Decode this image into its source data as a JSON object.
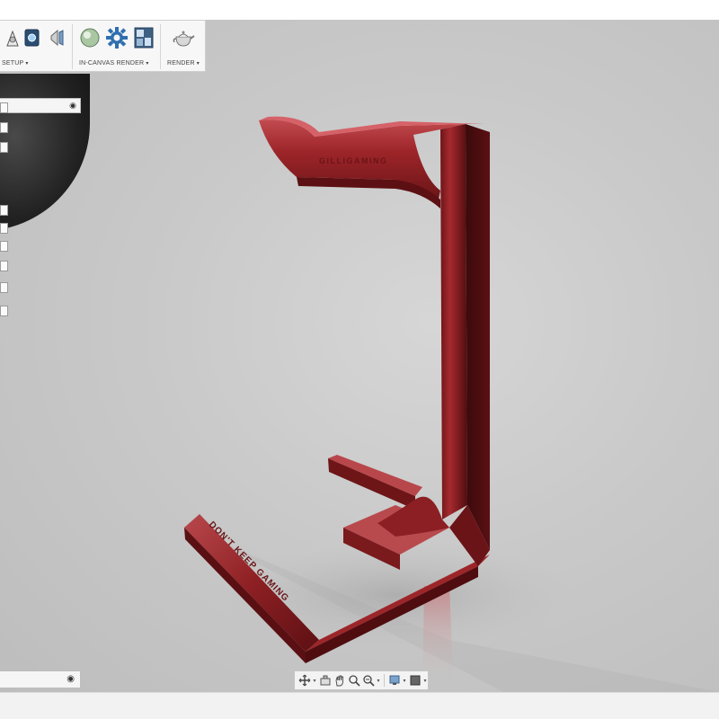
{
  "toolbar": {
    "groups": [
      {
        "label": "SETUP",
        "caret": "▾"
      },
      {
        "label": "IN-CANVAS RENDER",
        "caret": "▾"
      },
      {
        "label": "RENDER",
        "caret": "▾"
      }
    ],
    "icons": [
      "appearance-icon",
      "scene-settings-icon",
      "decal-icon",
      "in-canvas-render-icon",
      "render-settings-icon",
      "render-gallery-icon",
      "render-teapot-icon"
    ]
  },
  "model": {
    "top_engraving": "GILLIGAMING",
    "base_engraving": "DON'T KEEP GAMING",
    "color": "#8a1e22"
  },
  "navbar": {
    "tools": [
      "orbit-icon",
      "look-at-icon",
      "pan-icon",
      "zoom-icon",
      "fit-icon",
      "display-settings-icon",
      "grid-icon"
    ]
  },
  "panels": {
    "browser_mark": "◉",
    "bottom_mark": "◉"
  }
}
